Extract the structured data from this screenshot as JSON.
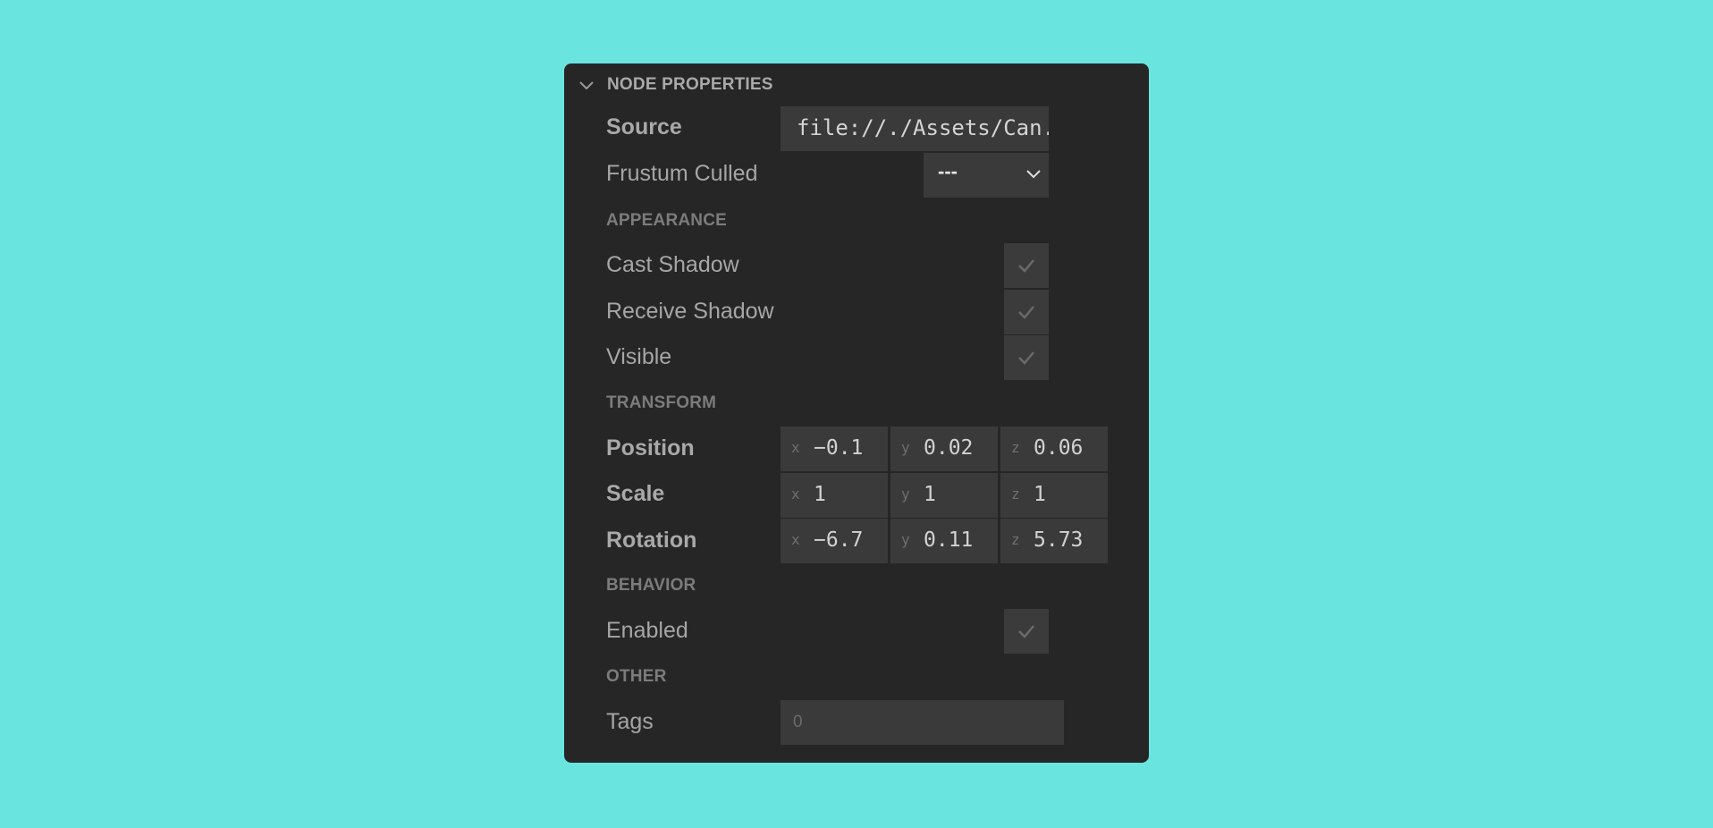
{
  "panel": {
    "title": "NODE PROPERTIES"
  },
  "source": {
    "label": "Source",
    "value": "file://./Assets/Can.glb"
  },
  "frustum": {
    "label": "Frustum Culled",
    "value": "---"
  },
  "appearance": {
    "title": "APPEARANCE",
    "cast_shadow": "Cast Shadow",
    "receive_shadow": "Receive Shadow",
    "visible": "Visible"
  },
  "transform": {
    "title": "TRANSFORM",
    "axes": {
      "x": "x",
      "y": "y",
      "z": "z"
    },
    "position": {
      "label": "Position",
      "x": "−0.1",
      "y": "0.02",
      "z": "0.06"
    },
    "scale": {
      "label": "Scale",
      "x": "1",
      "y": "1",
      "z": "1"
    },
    "rotation": {
      "label": "Rotation",
      "x": "−6.7",
      "y": "0.11",
      "z": "5.73"
    }
  },
  "behavior": {
    "title": "BEHAVIOR",
    "enabled": "Enabled"
  },
  "other": {
    "title": "OTHER",
    "tags_label": "Tags",
    "tags_placeholder": "0"
  },
  "colors": {
    "background": "#6ae4df",
    "panel": "#262626",
    "field": "#3a3a3a"
  }
}
